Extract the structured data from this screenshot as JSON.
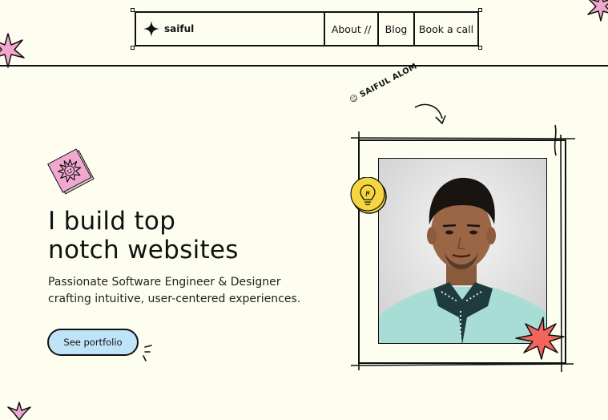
{
  "nav": {
    "brand": "saiful",
    "items": [
      {
        "label": "About //"
      },
      {
        "label": "Blog"
      },
      {
        "label": "Book a call"
      }
    ]
  },
  "hero": {
    "title_lines": [
      "I build top",
      "notch websites"
    ],
    "subtitle_lines": [
      "Passionate Software Engineer & Designer",
      "crafting intuitive, user-centered experiences."
    ],
    "cta_label": "See portfolio"
  },
  "profile": {
    "name_tag": "SAIFUL ALOM"
  },
  "colors": {
    "background": "#fdfdf0",
    "cta": "#bfe4f8",
    "pink_sticker": "#f2a7cf",
    "red_star": "#f2645c",
    "bulb_yellow": "#f6d640"
  }
}
